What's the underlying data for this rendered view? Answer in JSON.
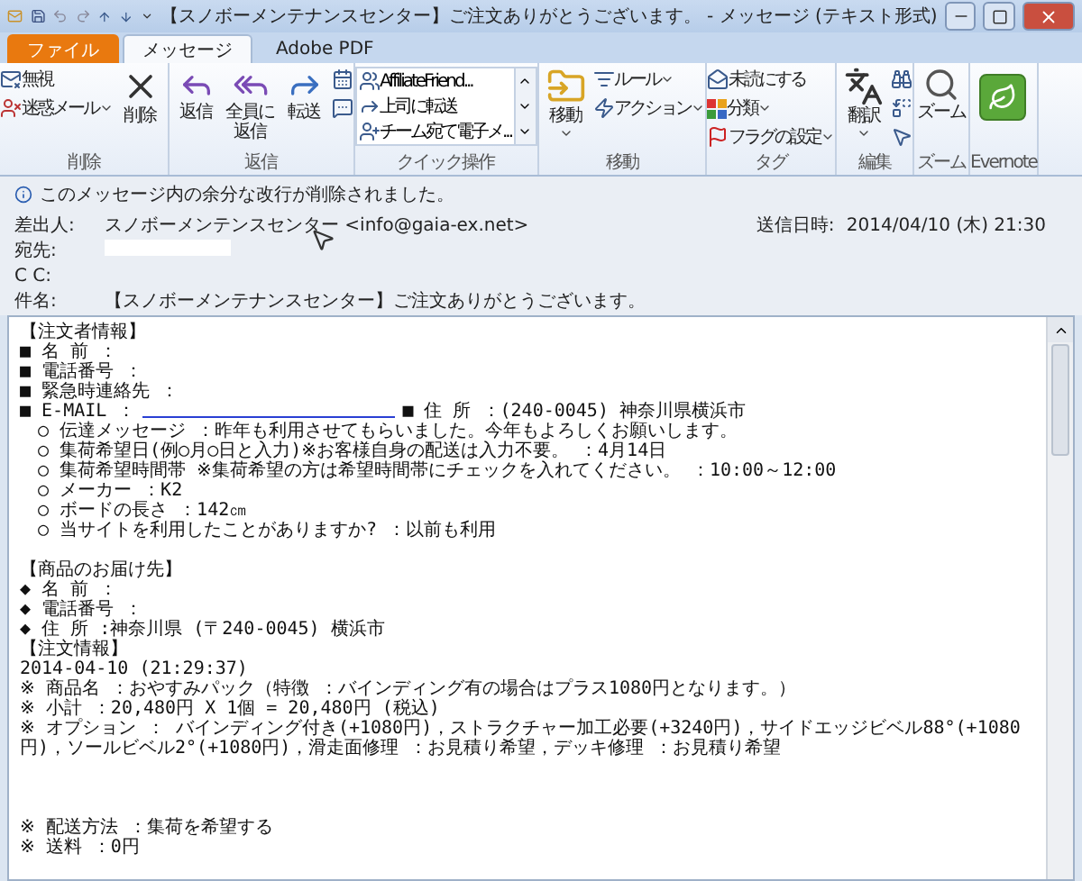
{
  "window": {
    "title": "【スノボーメンテナンスセンター】ご注文ありがとうございます。 - メッセージ (テキスト形式)"
  },
  "tabs": [
    {
      "label": "ファイル",
      "kind": "file",
      "selected": false
    },
    {
      "label": "メッセージ",
      "kind": "tab",
      "selected": true
    },
    {
      "label": "Adobe PDF",
      "kind": "tab",
      "selected": false
    }
  ],
  "ribbon": [
    {
      "label": "削除",
      "columns": [
        {
          "kind": "stack",
          "items": [
            {
              "label": "無視",
              "dropdown": false
            },
            {
              "label": "迷惑メール",
              "dropdown": true
            }
          ]
        },
        {
          "kind": "large",
          "label": "削除",
          "dropdown": false
        }
      ]
    },
    {
      "label": "返信",
      "columns": [
        {
          "kind": "large",
          "label": "返信",
          "dropdown": false
        },
        {
          "kind": "large",
          "label": "全員に返信",
          "dropdown": false
        },
        {
          "kind": "large",
          "label": "転送",
          "dropdown": false
        }
      ]
    },
    {
      "label": "クイック操作",
      "columns": [
        {
          "kind": "quick",
          "items": [
            {
              "label": "AffiliateFriend..."
            },
            {
              "label": "上司に転送"
            },
            {
              "label": "チーム宛て電子メ..."
            }
          ]
        }
      ]
    },
    {
      "label": "移動",
      "columns": [
        {
          "kind": "large",
          "label": "移動",
          "dropdown": true
        },
        {
          "kind": "stack",
          "items": [
            {
              "label": "ルール",
              "dropdown": true
            },
            {
              "label": "アクション",
              "dropdown": true
            }
          ]
        }
      ]
    },
    {
      "label": "タグ",
      "columns": [
        {
          "kind": "stack",
          "items": [
            {
              "label": "未読にする",
              "dropdown": false
            },
            {
              "label": "分類",
              "dropdown": true
            },
            {
              "label": "フラグの設定",
              "dropdown": true
            }
          ]
        }
      ]
    },
    {
      "label": "編集",
      "columns": [
        {
          "kind": "large",
          "label": "翻訳",
          "dropdown": true
        }
      ]
    },
    {
      "label": "ズーム",
      "columns": [
        {
          "kind": "large",
          "label": "ズーム",
          "dropdown": false
        }
      ]
    },
    {
      "label": "Evernote",
      "columns": [
        {
          "kind": "app"
        }
      ]
    }
  ],
  "info_bar": "このメッセージ内の余分な改行が削除されました。",
  "header": {
    "fields": [
      {
        "label": "差出人:",
        "value": "スノボーメンテンスセンター <info@gaia-ex.net>"
      },
      {
        "label": "宛先:",
        "redacted": true
      },
      {
        "label": "C C:"
      },
      {
        "label": "件名:",
        "value": "【スノボーメンテナンスセンター】ご注文ありがとうございます。"
      }
    ],
    "sent": {
      "label": "送信日時:",
      "value": "2014/04/10 (木) 21:30"
    }
  },
  "body": [
    {
      "kind": "text",
      "text": "【注文者情報】"
    },
    {
      "kind": "text",
      "text": "■ 名 前 ："
    },
    {
      "kind": "text",
      "text": "■ 電話番号 ："
    },
    {
      "kind": "text",
      "text": "■ 緊急時連絡先 ："
    },
    {
      "kind": "email",
      "text": "■ E-MAIL ：",
      "after": "■ 住 所 ：(240-0045) 神奈川県横浜市"
    },
    {
      "kind": "text",
      "text": "　○ 伝達メッセージ ：昨年も利用させてもらいました。今年もよろしくお願いします。"
    },
    {
      "kind": "text",
      "text": "　○ 集荷希望日(例○月○日と入力)※お客様自身の配送は入力不要。 ：4月14日"
    },
    {
      "kind": "text",
      "text": "　○ 集荷希望時間帯 ※集荷希望の方は希望時間帯にチェックを入れてください。 ：10:00～12:00"
    },
    {
      "kind": "text",
      "text": "　○ メーカー ：K2"
    },
    {
      "kind": "text",
      "text": "　○ ボードの長さ ：142㎝"
    },
    {
      "kind": "text",
      "text": "　○ 当サイトを利用したことがありますか? ：以前も利用"
    },
    {
      "kind": "gap"
    },
    {
      "kind": "text",
      "text": "【商品のお届け先】"
    },
    {
      "kind": "text",
      "text": "◆ 名 前 ："
    },
    {
      "kind": "text",
      "text": "◆ 電話番号 ："
    },
    {
      "kind": "text",
      "text": "◆ 住 所 :神奈川県 (〒240-0045) 横浜市"
    },
    {
      "kind": "text",
      "text": "【注文情報】"
    },
    {
      "kind": "text",
      "text": "2014-04-10 (21:29:37)"
    },
    {
      "kind": "text",
      "text": "※ 商品名 ：おやすみパック（特徴 ：バインディング有の場合はプラス1080円となります。）"
    },
    {
      "kind": "text",
      "text": "※ 小計 ：20,480円 X 1個 = 20,480円 (税込)"
    },
    {
      "kind": "text",
      "text": "※ オプション ： バインディング付き(+1080円)，ストラクチャー加工必要(+3240円)，サイドエッジビベル88°(+1080円)，ソールビベル2°(+1080円)，滑走面修理 ：お見積り希望，デッキ修理 ：お見積り希望"
    },
    {
      "kind": "gap"
    },
    {
      "kind": "gap"
    },
    {
      "kind": "gap"
    },
    {
      "kind": "text",
      "text": "※ 配送方法 ：集荷を希望する"
    },
    {
      "kind": "text",
      "text": "※ 送料 ：0円"
    }
  ]
}
